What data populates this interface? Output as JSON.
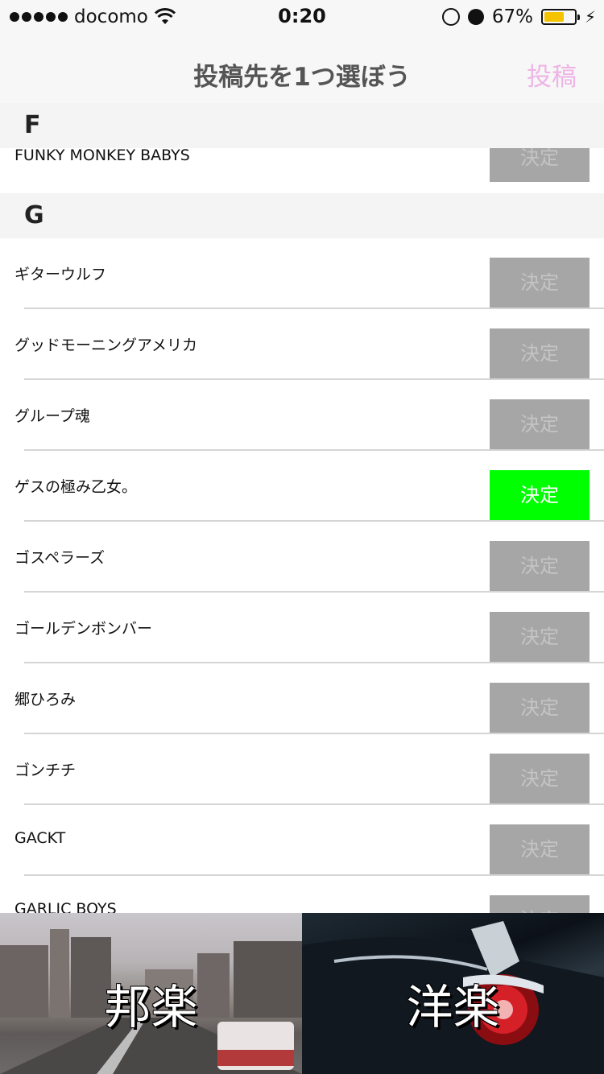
{
  "status_bar": {
    "carrier": "docomo",
    "time": "0:20",
    "battery_percent": "67%",
    "battery_level": 0.67,
    "battery_color": "#f5c400"
  },
  "nav": {
    "title": "投稿先を1つ選ぼう",
    "post_button": "投稿",
    "post_color": "#eeb4e6"
  },
  "sections": [
    {
      "letter": "F",
      "items": [
        {
          "name": "FUNKY MONKEY BABYS",
          "button": "決定",
          "selected": false
        }
      ]
    },
    {
      "letter": "G",
      "items": [
        {
          "name": "ギターウルフ",
          "button": "決定",
          "selected": false
        },
        {
          "name": "グッドモーニングアメリカ",
          "button": "決定",
          "selected": false
        },
        {
          "name": "グループ魂",
          "button": "決定",
          "selected": false
        },
        {
          "name": "ゲスの極み乙女。",
          "button": "決定",
          "selected": true
        },
        {
          "name": "ゴスペラーズ",
          "button": "決定",
          "selected": false
        },
        {
          "name": "ゴールデンボンバー",
          "button": "決定",
          "selected": false
        },
        {
          "name": "郷ひろみ",
          "button": "決定",
          "selected": false
        },
        {
          "name": "ゴンチチ",
          "button": "決定",
          "selected": false
        },
        {
          "name": "GACKT",
          "button": "決定",
          "selected": false
        },
        {
          "name": "GARLIC BOYS",
          "button": "決定",
          "selected": false
        }
      ]
    }
  ],
  "colors": {
    "button_default": "#a6a6a6",
    "button_selected": "#00ff00"
  },
  "tabs": [
    {
      "label": "邦楽",
      "icon": "city-street-photo"
    },
    {
      "label": "洋楽",
      "icon": "car-taillight-photo"
    }
  ]
}
